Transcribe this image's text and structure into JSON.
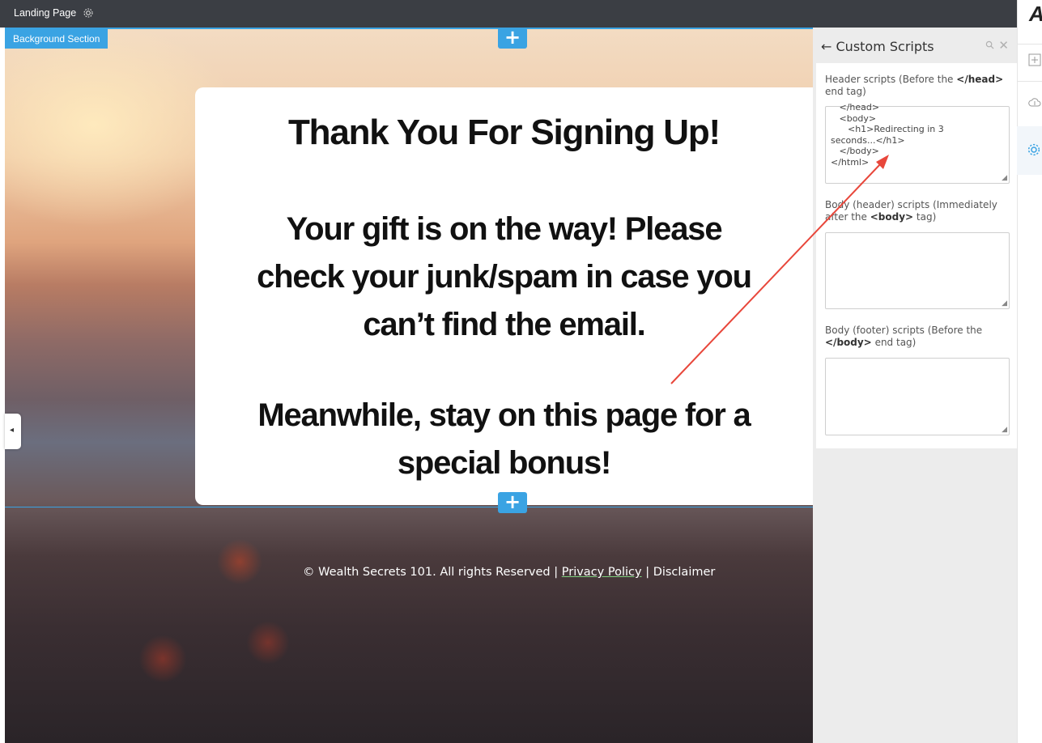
{
  "topbar": {
    "title": "Landing Page",
    "settings_icon": "gear-icon"
  },
  "section": {
    "tag": "Background Section",
    "add_icon": "+"
  },
  "card": {
    "title": "Thank You For Signing Up!",
    "gift_lines": [
      "Your gift is on the way! Please",
      "check your junk/spam in case you",
      "can’t find the email."
    ],
    "meanwhile_lines": [
      "Meanwhile, stay on this page for a",
      "special bonus!"
    ]
  },
  "footer": {
    "copyright": "© Wealth Secrets 101. All rights Reserved",
    "separator": "|",
    "privacy": "Privacy Policy",
    "disclaimer": "Disclaimer"
  },
  "panel": {
    "back_arrow": "←",
    "title": "Custom Scripts",
    "header_label_pre": "Header scripts (Before the ",
    "header_label_tag": "</head>",
    "header_label_post": " end tag)",
    "header_code": "   </head>\n   <body>\n      <h1>Redirecting in 3\nseconds...</h1>\n   </body>\n</html>",
    "body_label_pre": "Body (header) scripts (Immediately after the ",
    "body_label_tag": "<body>",
    "body_label_post": " tag)",
    "footer_label_pre": "Body (footer) scripts (Before the ",
    "footer_label_tag": "</body>",
    "footer_label_post": " end tag)",
    "close_icon": "✕"
  },
  "rail": {
    "logo": "A"
  },
  "colors": {
    "accent": "#3aa3e3",
    "annotation": "#e8473b",
    "topbar": "#3b3e44"
  }
}
